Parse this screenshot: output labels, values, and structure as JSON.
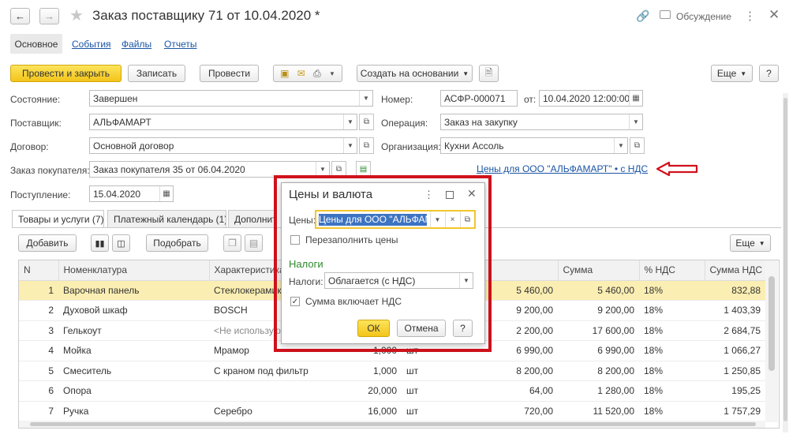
{
  "window": {
    "title": "Заказ поставщику 71 от 10.04.2020 *",
    "discussion_label": "Обсуждение"
  },
  "nav_tabs": [
    "Основное",
    "События",
    "Файлы",
    "Отчеты"
  ],
  "toolbar": {
    "post_close": "Провести и закрыть",
    "save": "Записать",
    "post": "Провести",
    "create_based": "Создать на основании",
    "more": "Еще",
    "help": "?"
  },
  "form": {
    "state_label": "Состояние:",
    "state_value": "Завершен",
    "supplier_label": "Поставщик:",
    "supplier_value": "АЛЬФАМАРТ",
    "contract_label": "Договор:",
    "contract_value": "Основной договор",
    "customer_order_label": "Заказ покупателя:",
    "customer_order_value": "Заказ покупателя 35 от 06.04.2020",
    "receipt_label": "Поступление:",
    "receipt_value": "15.04.2020",
    "number_label": "Номер:",
    "number_value": "АСФР-000071",
    "from_label": "от:",
    "date_value": "10.04.2020 12:00:00",
    "operation_label": "Операция:",
    "operation_value": "Заказ на закупку",
    "organization_label": "Организация:",
    "organization_value": "Кухни Ассоль",
    "prices_link": "Цены для ООО \"АЛЬФАМАРТ\" • с НДС"
  },
  "section_tabs": [
    "Товары и услуги (7)",
    "Платежный календарь (1)",
    "Дополнительно"
  ],
  "table_toolbar": {
    "add": "Добавить",
    "pick": "Подобрать",
    "more": "Еще"
  },
  "table": {
    "columns": [
      "N",
      "Номенклатура",
      "Характеристика",
      "",
      "",
      "",
      "Сумма",
      "% НДС",
      "Сумма НДС"
    ],
    "rows": [
      {
        "n": "1",
        "name": "Варочная панель",
        "char": "Стеклокерамика",
        "qty": "",
        "unit": "",
        "price": "5 460,00",
        "sum": "5 460,00",
        "vat": "18%",
        "vat_sum": "832,88"
      },
      {
        "n": "2",
        "name": "Духовой шкаф",
        "char": "BOSCH",
        "qty": "",
        "unit": "",
        "price": "9 200,00",
        "sum": "9 200,00",
        "vat": "18%",
        "vat_sum": "1 403,39"
      },
      {
        "n": "3",
        "name": "Гелькоут",
        "char": "<Не используются>",
        "qty": "",
        "unit": "",
        "price": "2 200,00",
        "sum": "17 600,00",
        "vat": "18%",
        "vat_sum": "2 684,75"
      },
      {
        "n": "4",
        "name": "Мойка",
        "char": "Мрамор",
        "qty": "1,000",
        "unit": "шт",
        "price": "6 990,00",
        "sum": "6 990,00",
        "vat": "18%",
        "vat_sum": "1 066,27"
      },
      {
        "n": "5",
        "name": "Смеситель",
        "char": "С краном под фильтр",
        "qty": "1,000",
        "unit": "шт",
        "price": "8 200,00",
        "sum": "8 200,00",
        "vat": "18%",
        "vat_sum": "1 250,85"
      },
      {
        "n": "6",
        "name": "Опора",
        "char": "",
        "qty": "20,000",
        "unit": "шт",
        "price": "64,00",
        "sum": "1 280,00",
        "vat": "18%",
        "vat_sum": "195,25"
      },
      {
        "n": "7",
        "name": "Ручка",
        "char": "Серебро",
        "qty": "16,000",
        "unit": "шт",
        "price": "720,00",
        "sum": "11 520,00",
        "vat": "18%",
        "vat_sum": "1 757,29"
      }
    ]
  },
  "dialog": {
    "title": "Цены и валюта",
    "prices_label": "Цены:",
    "prices_value": "Цены для ООО \"АЛЬФАМАРТ\"",
    "refill_label": "Перезаполнить цены",
    "refill_checked": false,
    "taxes_header": "Налоги",
    "taxes_label": "Налоги:",
    "taxes_value": "Облагается (с НДС)",
    "vat_included_label": "Сумма включает НДС",
    "vat_included_checked": true,
    "ok": "ОК",
    "cancel": "Отмена",
    "help": "?"
  },
  "colors": {
    "accent_yellow": "#f3c41a",
    "highlight_red": "#d0121c",
    "link_blue": "#1a55a5",
    "taxes_green": "#2e8a2e",
    "selected_row": "#fbeeb2"
  }
}
